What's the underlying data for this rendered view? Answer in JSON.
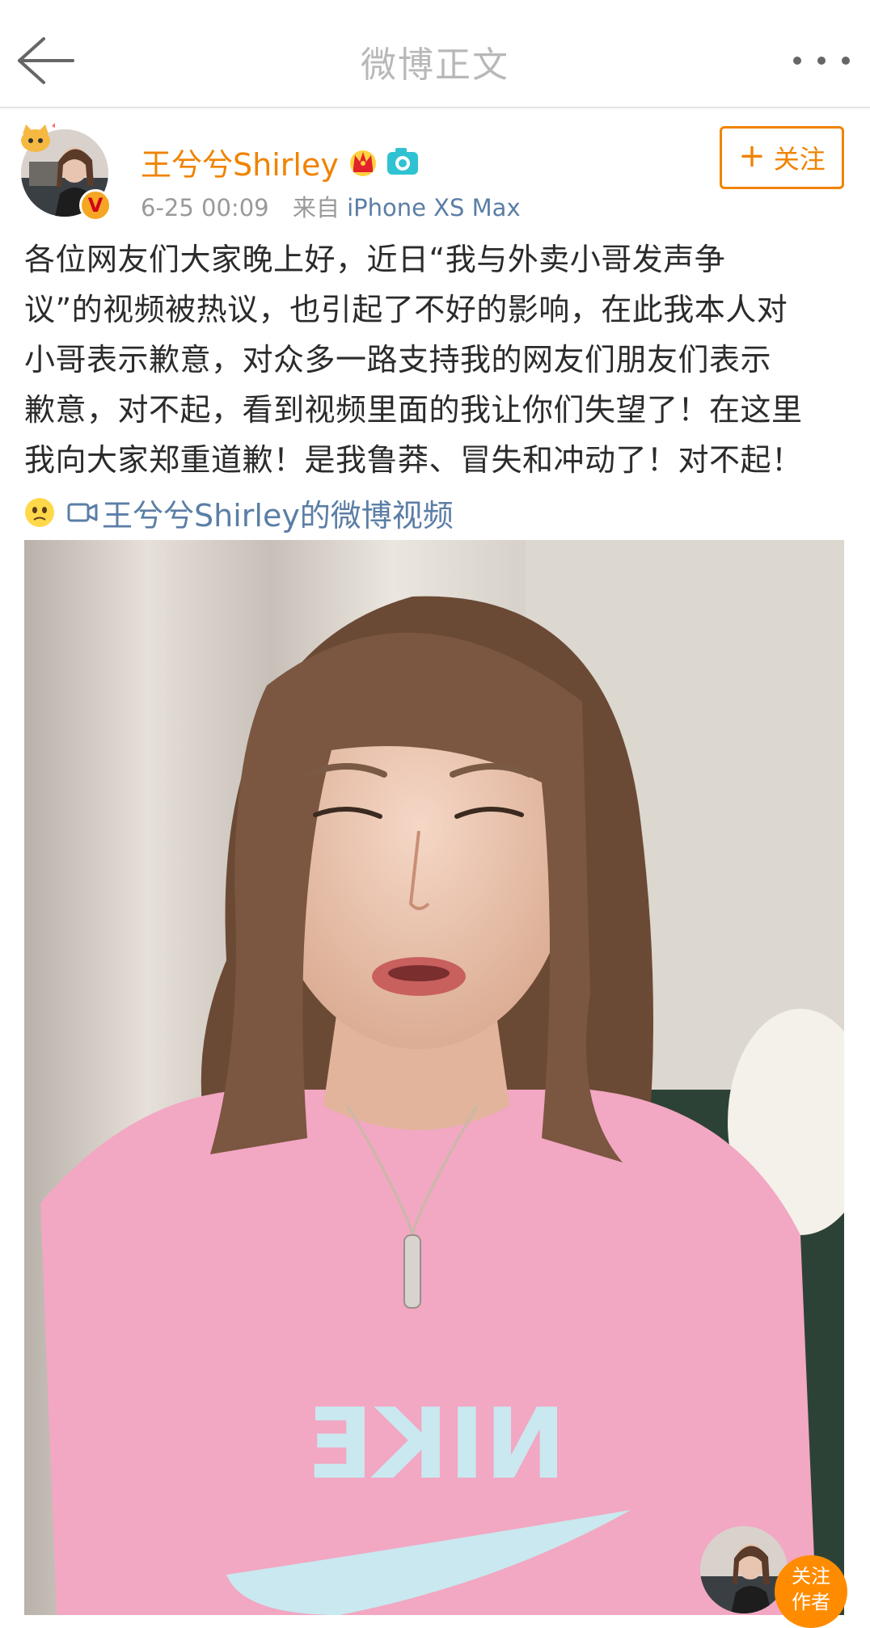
{
  "nav": {
    "title": "微博正文"
  },
  "author": {
    "name": "王兮兮Shirley",
    "time": "6-25 00:09",
    "source_prefix": "来自",
    "device": "iPhone XS Max",
    "verified_mark": "V",
    "follow_label": "关注",
    "follow_plus": "+"
  },
  "post": {
    "lines": [
      "各位网友们大家晚上好，近日“我与外卖小哥发声争",
      "议”的视频被热议，也引起了不好的影响，在此我本人对",
      "小哥表示歉意，对众多一路支持我的网友们朋友们表示",
      "歉意，对不起，看到视频里面的我让你们失望了！在这里",
      "我向大家郑重道歉！是我鲁莽、冒失和冲动了！对不起！"
    ],
    "video_link": "王兮兮Shirley的微博视频"
  },
  "video": {
    "shirt_text": "NIKE"
  },
  "float_follow": {
    "line1": "关注",
    "line2": "作者"
  },
  "colors": {
    "accent": "#f08300",
    "link": "#5b7ea6",
    "meta": "#9a9a9a",
    "title": "#b8b8b8"
  },
  "icons": [
    "back-arrow-icon",
    "more-dots-icon",
    "crown-icon",
    "camera-icon",
    "sad-emoji-icon",
    "video-icon",
    "verified-icon"
  ]
}
